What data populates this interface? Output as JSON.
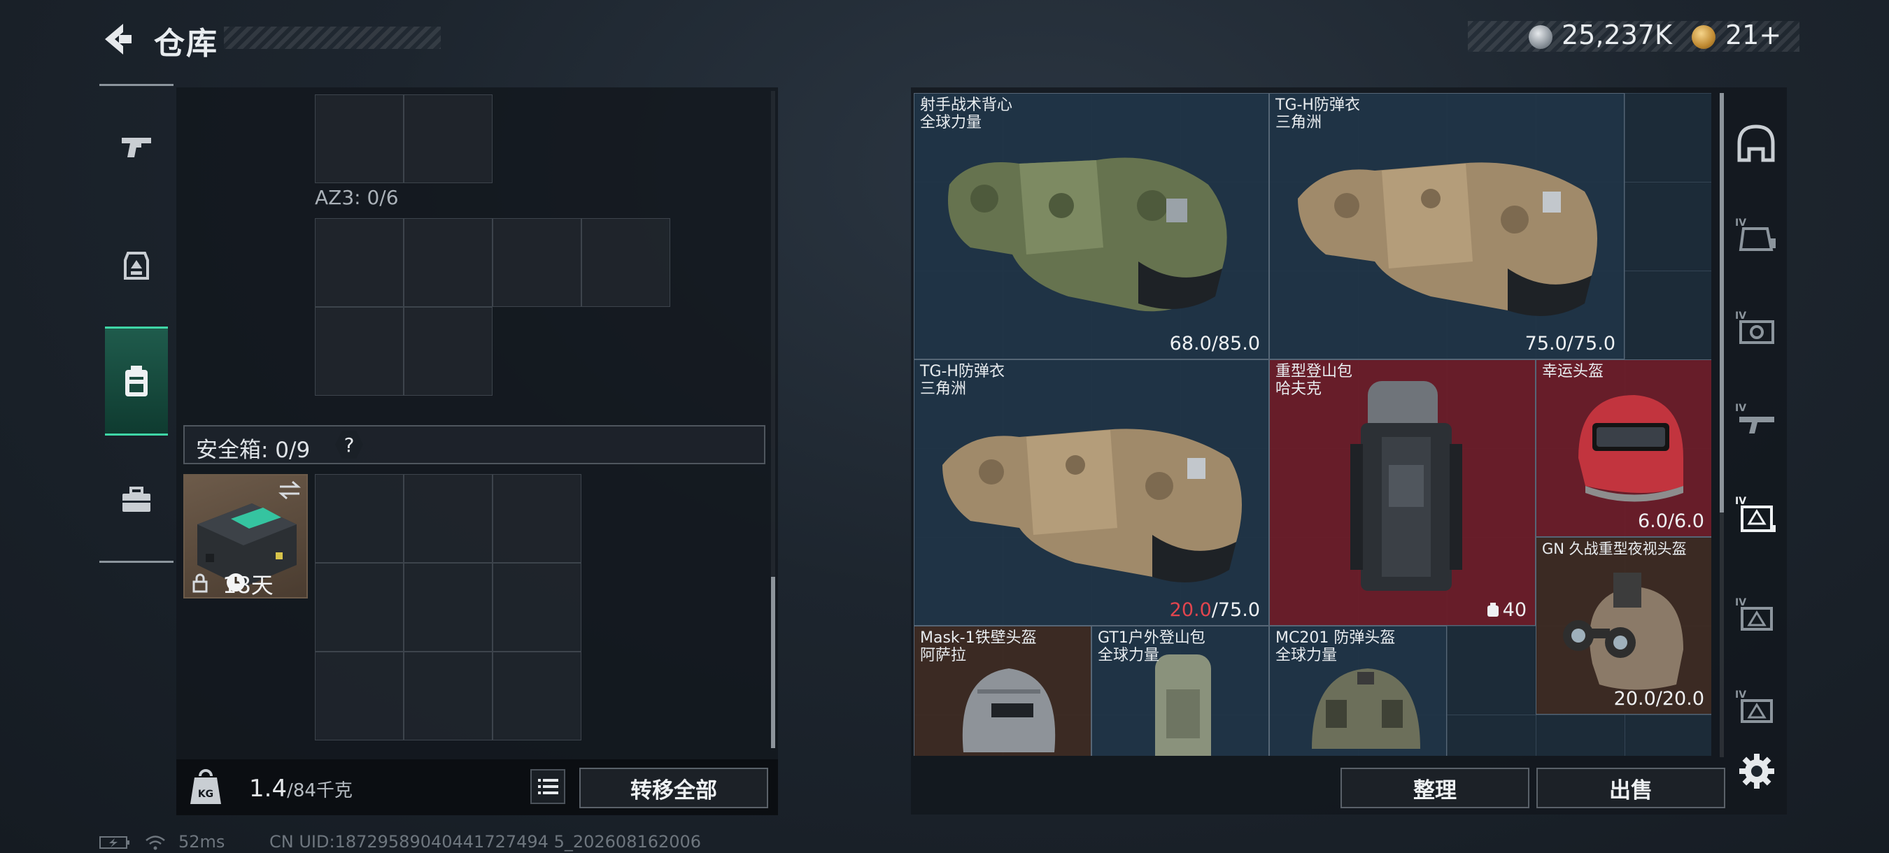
{
  "header": {
    "title": "仓库",
    "back_icon": "back-arrow-icon"
  },
  "currency": {
    "silver": "25,237K",
    "gold": "21+"
  },
  "left_nav": [
    {
      "icon": "pistol-icon",
      "active": false
    },
    {
      "icon": "chest-rig-icon",
      "active": false
    },
    {
      "icon": "backpack-icon",
      "active": true
    },
    {
      "icon": "briefcase-icon",
      "active": false
    }
  ],
  "container": {
    "az3_label": "AZ3: 0/6"
  },
  "safebox": {
    "label": "安全箱: 0/9",
    "help": "?",
    "case_days": "18天",
    "case_swap_icon": "swap-icon",
    "case_lock_icon": "lock-icon",
    "case_clock_icon": "clock-icon"
  },
  "footer_left": {
    "weight": "1.4",
    "weight_max": "/84千克",
    "transfer_all": "转移全部"
  },
  "status": {
    "ping": "52ms",
    "uid": "CN UID:18729589040441727494 5_202608162006"
  },
  "items": [
    {
      "name": "射手战术背心\n全球力量",
      "dur_current": "68.0",
      "dur_max": "/85.0"
    },
    {
      "name": "TG-H防弹衣\n三角洲",
      "dur_current": "75.0",
      "dur_max": "/75.0"
    },
    {
      "name": "TG-H防弹衣\n三角洲",
      "dur_current": "20.0",
      "dur_max": "/75.0"
    },
    {
      "name": "重型登山包\n哈夫克",
      "capacity": "40"
    },
    {
      "name": "幸运头盔",
      "dur_current": "6.0",
      "dur_max": "/6.0"
    },
    {
      "name": "GN 久战重型夜视头盔",
      "dur_current": "20.0",
      "dur_max": "/20.0"
    },
    {
      "name": "Mask-1铁壁头盔\n阿萨拉"
    },
    {
      "name": "GT1户外登山包\n全球力量"
    },
    {
      "name": "MC201 防弹头盔\n全球力量"
    }
  ],
  "right_nav": [
    {
      "icon": "helmet-icon"
    },
    {
      "icon": "armor-iv-icon"
    },
    {
      "icon": "rig-iv-icon"
    },
    {
      "icon": "weapon-iv-icon"
    },
    {
      "icon": "backpack-iv-icon"
    },
    {
      "icon": "case-iv-icon"
    },
    {
      "icon": "misc-iv-icon"
    }
  ],
  "footer_right": {
    "sort": "整理",
    "sell": "出售"
  },
  "colors": {
    "accent_green": "#3fd6a6",
    "durability_low": "#e2454e"
  }
}
